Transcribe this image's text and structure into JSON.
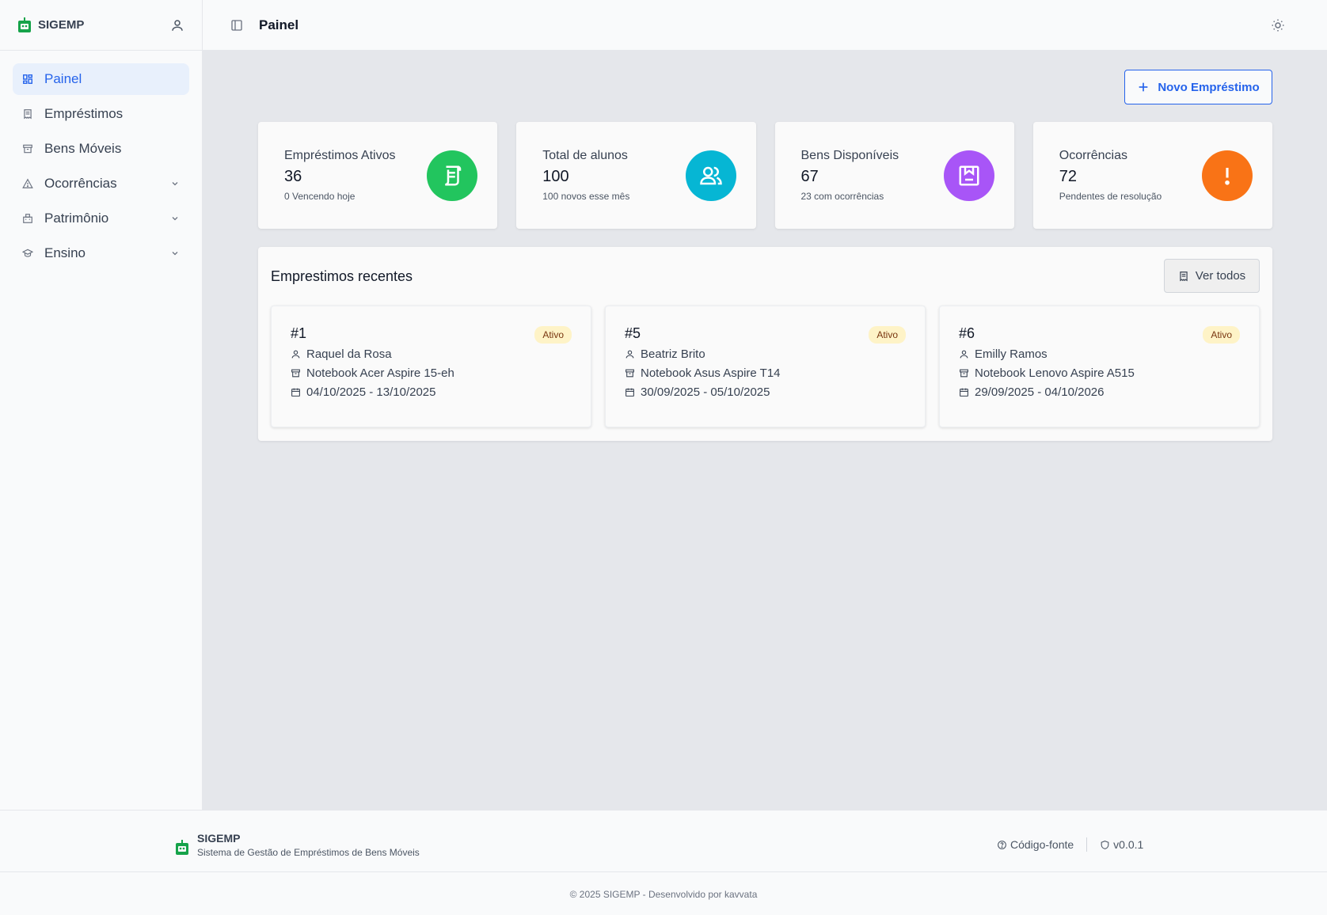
{
  "app": {
    "name": "SIGEMP"
  },
  "sidebar": {
    "items": [
      {
        "label": "Painel",
        "icon": "dashboard-icon",
        "active": true
      },
      {
        "label": "Empréstimos",
        "icon": "receipt-icon"
      },
      {
        "label": "Bens Móveis",
        "icon": "archive-icon"
      },
      {
        "label": "Ocorrências",
        "icon": "warning-icon",
        "expandable": true
      },
      {
        "label": "Patrimônio",
        "icon": "building-icon",
        "expandable": true
      },
      {
        "label": "Ensino",
        "icon": "graduation-cap-icon",
        "expandable": true
      }
    ]
  },
  "topbar": {
    "title": "Painel"
  },
  "main": {
    "new_button": "Novo Empréstimo",
    "stats": [
      {
        "label": "Empréstimos Ativos",
        "value": "36",
        "sub": "0 Vencendo hoje",
        "color": "#22c55e",
        "icon": "receipt-icon"
      },
      {
        "label": "Total de alunos",
        "value": "100",
        "sub": "100 novos esse mês",
        "color": "#06b6d4",
        "icon": "users-icon"
      },
      {
        "label": "Bens Disponíveis",
        "value": "67",
        "sub": "23 com ocorrências",
        "color": "#a855f7",
        "icon": "package-icon"
      },
      {
        "label": "Ocorrências",
        "value": "72",
        "sub": "Pendentes de resolução",
        "color": "#f97316",
        "icon": "exclamation-icon"
      }
    ],
    "recent": {
      "title": "Emprestimos recentes",
      "see_all": "Ver todos",
      "loans": [
        {
          "id": "#1",
          "status": "Ativo",
          "person": "Raquel da Rosa",
          "item": "Notebook Acer Aspire 15-eh",
          "dates": "04/10/2025 - 13/10/2025"
        },
        {
          "id": "#5",
          "status": "Ativo",
          "person": "Beatriz Brito",
          "item": "Notebook Asus Aspire T14",
          "dates": "30/09/2025 - 05/10/2025"
        },
        {
          "id": "#6",
          "status": "Ativo",
          "person": "Emilly Ramos",
          "item": "Notebook Lenovo Aspire A515",
          "dates": "29/09/2025 - 04/10/2026"
        }
      ]
    }
  },
  "footer": {
    "name": "SIGEMP",
    "description": "Sistema de Gestão de Empréstimos de Bens Móveis",
    "source_link": "Código-fonte",
    "version": "v0.0.1",
    "copyright": "© 2025 SIGEMP - Desenvolvido por kavvata"
  },
  "colors": {
    "accent": "#2563eb",
    "active_bg": "#e8f0fc",
    "logo": "#16a34a",
    "badge_bg": "#fef3c7"
  }
}
